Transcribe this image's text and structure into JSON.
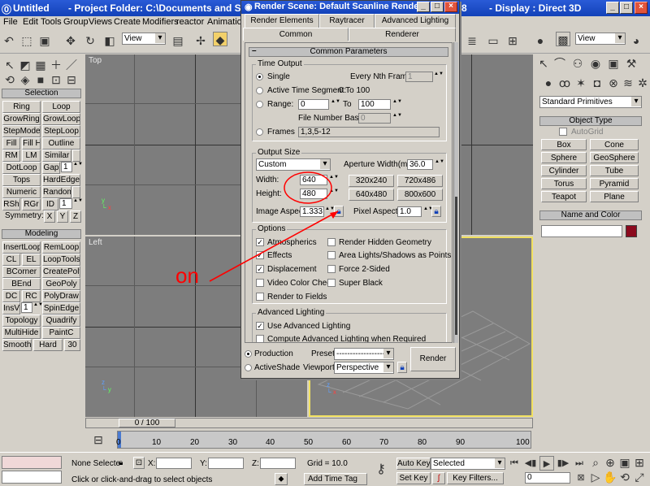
{
  "window": {
    "title": "Untitled",
    "project": "- Project Folder: C:\\Documents and SettingsW",
    "display": "- Display : Direct 3D",
    "display_prefix": "8"
  },
  "menu": [
    "File",
    "Edit",
    "Tools",
    "Group",
    "Views",
    "Create",
    "Modifiers",
    "reactor",
    "Animation"
  ],
  "toolbar": {
    "view_dropdown": "View",
    "view_dropdown2": "View"
  },
  "left_panel": {
    "selection_title": "Selection",
    "selection_buttons": [
      "Ring",
      "Loop",
      "GrowRing",
      "GrowLoop",
      "StepMode",
      "StepLoop",
      "Fill",
      "Fill H",
      "Outline",
      "RM",
      "LM",
      "Similar",
      "DotLoop",
      "Gap",
      "1",
      "Tops",
      "HardEdges",
      "Numeric",
      "Random",
      "RSh",
      "RGr",
      "ID",
      "1"
    ],
    "symmetry": "Symmetry:",
    "sym_axes": [
      "X",
      "Y",
      "Z"
    ],
    "modeling_title": "Modeling",
    "modeling_buttons": [
      "InsertLoop",
      "RemLoop",
      "CL",
      "EL",
      "LoopTools",
      "BCorner",
      "CreatePoly",
      "BEnd",
      "GeoPoly",
      "DC",
      "RC",
      "PolyDraw",
      "InsV",
      "1",
      "SpinEdge",
      "Topology",
      "Quadrify",
      "MultiHide",
      "PaintC",
      "Smooth",
      "Hard",
      "30"
    ]
  },
  "viewports": {
    "top": "Top",
    "left": "Left"
  },
  "right_panel": {
    "dropdown": "Standard Primitives",
    "object_type_title": "Object Type",
    "autogrid": "AutoGrid",
    "objects": [
      "Box",
      "Cone",
      "Sphere",
      "GeoSphere",
      "Cylinder",
      "Tube",
      "Torus",
      "Pyramid",
      "Teapot",
      "Plane"
    ],
    "name_color_title": "Name and Color",
    "color": "#8b0a1e"
  },
  "dialog": {
    "title": "Render Scene: Default Scanline Rende...",
    "tabs_row1": [
      "Render Elements",
      "Raytracer",
      "Advanced Lighting"
    ],
    "tabs_row2": [
      "Common",
      "Renderer"
    ],
    "rollout_title": "Common Parameters",
    "time_output": {
      "title": "Time Output",
      "single": "Single",
      "every_nth": "Every Nth Frame:",
      "every_nth_value": "1",
      "active_segment": "Active Time Segment:",
      "active_segment_value": "0 To 100",
      "range": "Range:",
      "range_from": "0",
      "range_to_label": "To",
      "range_to": "100",
      "file_number_base": "File Number Base:",
      "file_number_base_value": "0",
      "frames": "Frames",
      "frames_value": "1,3,5-12"
    },
    "output_size": {
      "title": "Output Size",
      "preset": "Custom",
      "aperture_label": "Aperture Width(mm):",
      "aperture_value": "36.0",
      "width_label": "Width:",
      "width_value": "640",
      "height_label": "Height:",
      "height_value": "480",
      "presets": [
        "320x240",
        "720x486",
        "640x480",
        "800x600"
      ],
      "image_aspect_label": "Image Aspect:",
      "image_aspect_value": "1.333",
      "pixel_aspect_label": "Pixel Aspect:",
      "pixel_aspect_value": "1.0"
    },
    "options": {
      "title": "Options",
      "items": [
        {
          "label": "Atmospherics",
          "checked": true
        },
        {
          "label": "Render Hidden Geometry",
          "checked": false
        },
        {
          "label": "Effects",
          "checked": true
        },
        {
          "label": "Area Lights/Shadows as Points",
          "checked": false
        },
        {
          "label": "Displacement",
          "checked": true
        },
        {
          "label": "Force 2-Sided",
          "checked": false
        },
        {
          "label": "Video Color Check",
          "checked": false
        },
        {
          "label": "Super Black",
          "checked": false
        },
        {
          "label": "Render to Fields",
          "checked": false
        }
      ]
    },
    "advanced_lighting": {
      "title": "Advanced Lighting",
      "use": "Use Advanced Lighting",
      "compute": "Compute Advanced Lighting when Required"
    },
    "bottom": {
      "production": "Production",
      "activeshade": "ActiveShade",
      "preset_label": "Preset:",
      "preset_value": "-------------------",
      "viewport_label": "Viewport:",
      "viewport_value": "Perspective",
      "render": "Render"
    }
  },
  "annotation": {
    "text": "on",
    "color": "#ff0000"
  },
  "timeline": {
    "frame": "0 / 100",
    "ticks": [
      "0",
      "10",
      "20",
      "30",
      "40",
      "50",
      "60",
      "70",
      "80",
      "90",
      "100"
    ]
  },
  "status": {
    "selection": "None Selecte",
    "x_label": "X:",
    "y_label": "Y:",
    "z_label": "Z:",
    "grid": "Grid = 10.0",
    "auto_key": "Auto Key",
    "selected": "Selected",
    "set_key": "Set Key",
    "key_filters": "Key Filters...",
    "frame_value": "0",
    "prompt": "Click or click-and-drag to select objects",
    "add_time_tag": "Add Time Tag"
  }
}
